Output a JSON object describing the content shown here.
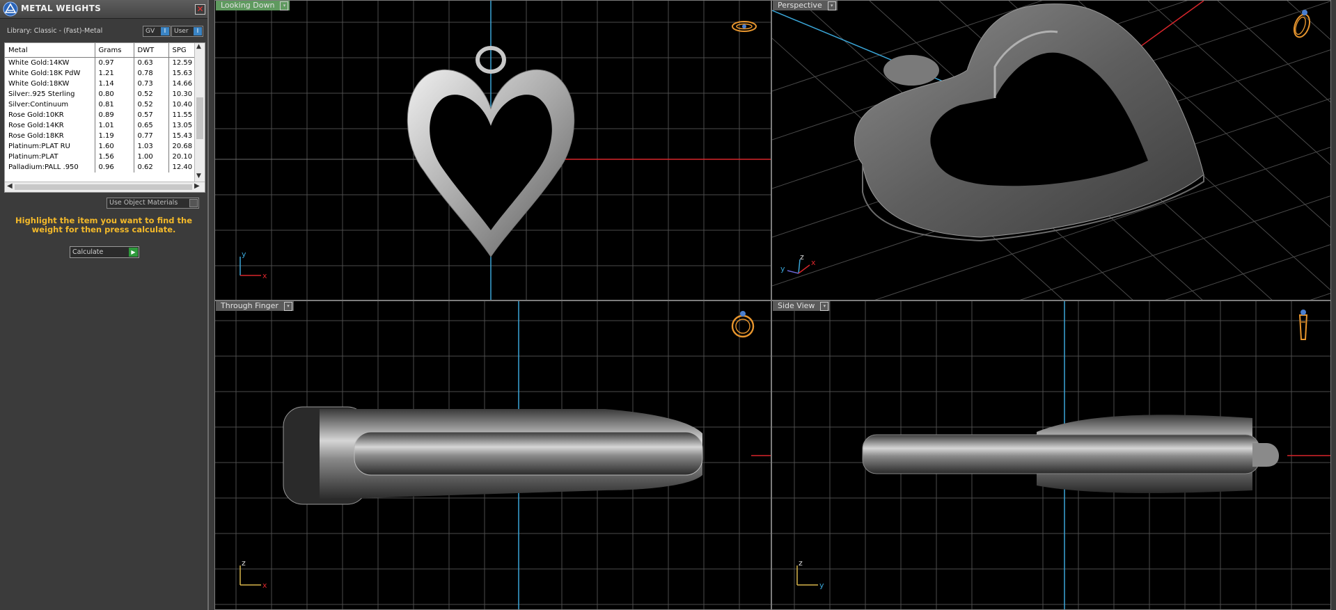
{
  "panel": {
    "title": "METAL WEIGHTS",
    "close_glyph": "✕",
    "library_label": "Library: Classic - (Fast)-Metal",
    "toggle_gv": "GV",
    "toggle_user": "User",
    "toggle_glyph": "I",
    "table": {
      "headers": [
        "Metal",
        "Grams",
        "DWT",
        "SPG"
      ],
      "rows": [
        [
          "White Gold:14KW",
          "0.97",
          "0.63",
          "12.59"
        ],
        [
          "White Gold:18K PdW",
          "1.21",
          "0.78",
          "15.63"
        ],
        [
          "White Gold:18KW",
          "1.14",
          "0.73",
          "14.66"
        ],
        [
          "Silver:.925 Sterling",
          "0.80",
          "0.52",
          "10.30"
        ],
        [
          "Silver:Continuum",
          "0.81",
          "0.52",
          "10.40"
        ],
        [
          "Rose Gold:10KR",
          "0.89",
          "0.57",
          "11.55"
        ],
        [
          "Rose Gold:14KR",
          "1.01",
          "0.65",
          "13.05"
        ],
        [
          "Rose Gold:18KR",
          "1.19",
          "0.77",
          "15.43"
        ],
        [
          "Platinum:PLAT RU",
          "1.60",
          "1.03",
          "20.68"
        ],
        [
          "Platinum:PLAT",
          "1.56",
          "1.00",
          "20.10"
        ],
        [
          "Palladium:PALL .950",
          "0.96",
          "0.62",
          "12.40"
        ]
      ]
    },
    "use_materials_label": "Use Object Materials",
    "instruction": "Highlight the item you want to find the weight for then press calculate.",
    "calculate_label": "Calculate",
    "calculate_glyph": "▶"
  },
  "viewports": {
    "top_left": {
      "label": "Looking Down",
      "axis_a": "y",
      "axis_b": "x",
      "icon": "ring-top-icon"
    },
    "top_right": {
      "label": "Perspective",
      "axis_a": "z",
      "axis_b": "y",
      "axis_c": "x",
      "icon": "ring-perspective-icon"
    },
    "bottom_left": {
      "label": "Through Finger",
      "axis_a": "z",
      "axis_b": "x",
      "icon": "ring-front-icon"
    },
    "bottom_right": {
      "label": "Side View",
      "axis_a": "z",
      "axis_b": "y",
      "icon": "ring-side-icon"
    }
  },
  "colors": {
    "grid": "#555555",
    "axis_blue": "#3aa6d8",
    "axis_red": "#d8252b",
    "label_bg_active": "#5f9a5f",
    "label_bg": "#5a5a5a",
    "ring_icon": "#e8962e",
    "instruction": "#f3b92a"
  },
  "caret_glyph": "▾"
}
